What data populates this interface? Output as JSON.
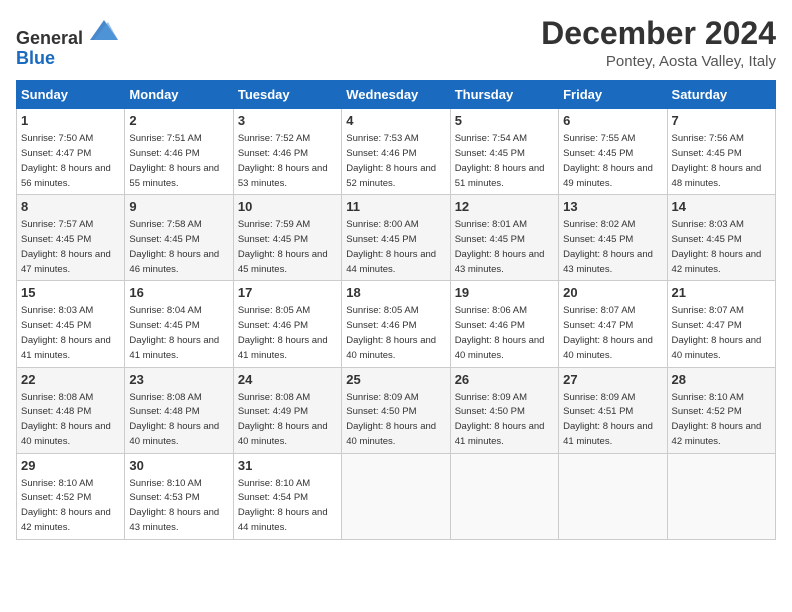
{
  "header": {
    "logo_general": "General",
    "logo_blue": "Blue",
    "title": "December 2024",
    "subtitle": "Pontey, Aosta Valley, Italy"
  },
  "weekdays": [
    "Sunday",
    "Monday",
    "Tuesday",
    "Wednesday",
    "Thursday",
    "Friday",
    "Saturday"
  ],
  "weeks": [
    [
      {
        "day": "1",
        "sunrise": "7:50 AM",
        "sunset": "4:47 PM",
        "daylight": "8 hours and 56 minutes."
      },
      {
        "day": "2",
        "sunrise": "7:51 AM",
        "sunset": "4:46 PM",
        "daylight": "8 hours and 55 minutes."
      },
      {
        "day": "3",
        "sunrise": "7:52 AM",
        "sunset": "4:46 PM",
        "daylight": "8 hours and 53 minutes."
      },
      {
        "day": "4",
        "sunrise": "7:53 AM",
        "sunset": "4:46 PM",
        "daylight": "8 hours and 52 minutes."
      },
      {
        "day": "5",
        "sunrise": "7:54 AM",
        "sunset": "4:45 PM",
        "daylight": "8 hours and 51 minutes."
      },
      {
        "day": "6",
        "sunrise": "7:55 AM",
        "sunset": "4:45 PM",
        "daylight": "8 hours and 49 minutes."
      },
      {
        "day": "7",
        "sunrise": "7:56 AM",
        "sunset": "4:45 PM",
        "daylight": "8 hours and 48 minutes."
      }
    ],
    [
      {
        "day": "8",
        "sunrise": "7:57 AM",
        "sunset": "4:45 PM",
        "daylight": "8 hours and 47 minutes."
      },
      {
        "day": "9",
        "sunrise": "7:58 AM",
        "sunset": "4:45 PM",
        "daylight": "8 hours and 46 minutes."
      },
      {
        "day": "10",
        "sunrise": "7:59 AM",
        "sunset": "4:45 PM",
        "daylight": "8 hours and 45 minutes."
      },
      {
        "day": "11",
        "sunrise": "8:00 AM",
        "sunset": "4:45 PM",
        "daylight": "8 hours and 44 minutes."
      },
      {
        "day": "12",
        "sunrise": "8:01 AM",
        "sunset": "4:45 PM",
        "daylight": "8 hours and 43 minutes."
      },
      {
        "day": "13",
        "sunrise": "8:02 AM",
        "sunset": "4:45 PM",
        "daylight": "8 hours and 43 minutes."
      },
      {
        "day": "14",
        "sunrise": "8:03 AM",
        "sunset": "4:45 PM",
        "daylight": "8 hours and 42 minutes."
      }
    ],
    [
      {
        "day": "15",
        "sunrise": "8:03 AM",
        "sunset": "4:45 PM",
        "daylight": "8 hours and 41 minutes."
      },
      {
        "day": "16",
        "sunrise": "8:04 AM",
        "sunset": "4:45 PM",
        "daylight": "8 hours and 41 minutes."
      },
      {
        "day": "17",
        "sunrise": "8:05 AM",
        "sunset": "4:46 PM",
        "daylight": "8 hours and 41 minutes."
      },
      {
        "day": "18",
        "sunrise": "8:05 AM",
        "sunset": "4:46 PM",
        "daylight": "8 hours and 40 minutes."
      },
      {
        "day": "19",
        "sunrise": "8:06 AM",
        "sunset": "4:46 PM",
        "daylight": "8 hours and 40 minutes."
      },
      {
        "day": "20",
        "sunrise": "8:07 AM",
        "sunset": "4:47 PM",
        "daylight": "8 hours and 40 minutes."
      },
      {
        "day": "21",
        "sunrise": "8:07 AM",
        "sunset": "4:47 PM",
        "daylight": "8 hours and 40 minutes."
      }
    ],
    [
      {
        "day": "22",
        "sunrise": "8:08 AM",
        "sunset": "4:48 PM",
        "daylight": "8 hours and 40 minutes."
      },
      {
        "day": "23",
        "sunrise": "8:08 AM",
        "sunset": "4:48 PM",
        "daylight": "8 hours and 40 minutes."
      },
      {
        "day": "24",
        "sunrise": "8:08 AM",
        "sunset": "4:49 PM",
        "daylight": "8 hours and 40 minutes."
      },
      {
        "day": "25",
        "sunrise": "8:09 AM",
        "sunset": "4:50 PM",
        "daylight": "8 hours and 40 minutes."
      },
      {
        "day": "26",
        "sunrise": "8:09 AM",
        "sunset": "4:50 PM",
        "daylight": "8 hours and 41 minutes."
      },
      {
        "day": "27",
        "sunrise": "8:09 AM",
        "sunset": "4:51 PM",
        "daylight": "8 hours and 41 minutes."
      },
      {
        "day": "28",
        "sunrise": "8:10 AM",
        "sunset": "4:52 PM",
        "daylight": "8 hours and 42 minutes."
      }
    ],
    [
      {
        "day": "29",
        "sunrise": "8:10 AM",
        "sunset": "4:52 PM",
        "daylight": "8 hours and 42 minutes."
      },
      {
        "day": "30",
        "sunrise": "8:10 AM",
        "sunset": "4:53 PM",
        "daylight": "8 hours and 43 minutes."
      },
      {
        "day": "31",
        "sunrise": "8:10 AM",
        "sunset": "4:54 PM",
        "daylight": "8 hours and 44 minutes."
      },
      null,
      null,
      null,
      null
    ]
  ]
}
